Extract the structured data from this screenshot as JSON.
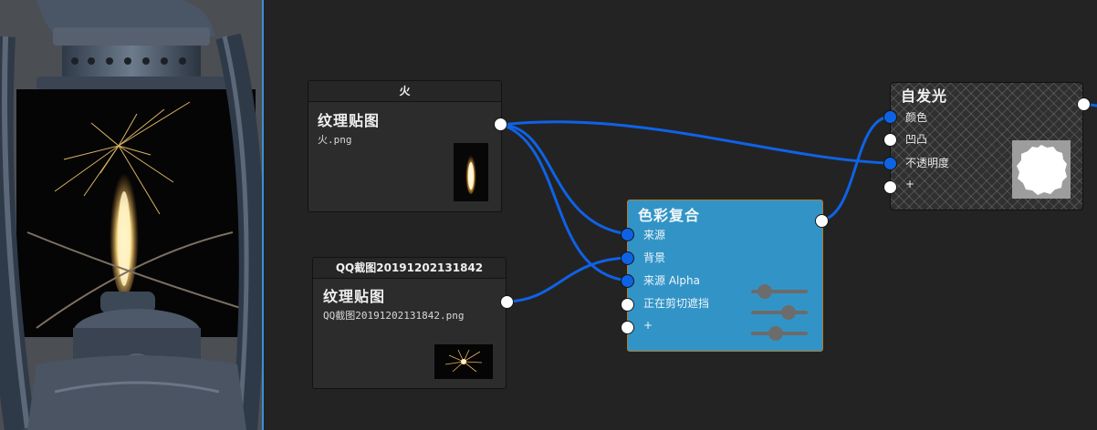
{
  "colors": {
    "wire": "#0f62e6",
    "port_connected": "#0d63e3",
    "port_free": "#ffffff",
    "composite_node": "#3294c6",
    "node_body": "#2c2c2c",
    "canvas": "#232323",
    "viewport_divider": "#3b8fd6"
  },
  "viewport": {
    "icon": "lantern-preview-image"
  },
  "nodes": {
    "fire_texture": {
      "header": "火",
      "title": "纹理贴图",
      "filename": "火.png",
      "thumbnail_icon": "flame-thumbnail"
    },
    "qq_texture": {
      "header": "QQ截图20191202131842",
      "title": "纹理贴图",
      "filename": "QQ截图20191202131842.png",
      "thumbnail_icon": "sparkler-thumbnail"
    },
    "color_composite": {
      "title": "色彩复合",
      "inputs": [
        "来源",
        "背景",
        "来源 Alpha",
        "正在剪切遮挡",
        "+"
      ]
    },
    "emissive": {
      "title": "自发光",
      "inputs": [
        "颜色",
        "凹凸",
        "不透明度",
        "+"
      ]
    }
  }
}
